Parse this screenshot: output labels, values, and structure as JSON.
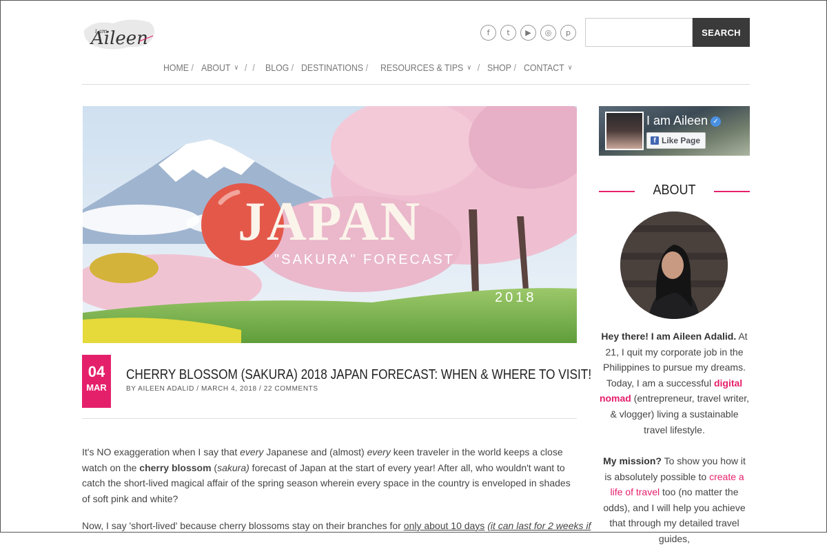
{
  "header": {
    "logo_alt": "I am Aileen",
    "logo_text_small": "i am",
    "logo_text": "Aileen",
    "social": [
      {
        "icon": "facebook-icon",
        "glyph": "f"
      },
      {
        "icon": "twitter-icon",
        "glyph": "t"
      },
      {
        "icon": "youtube-icon",
        "glyph": "▶"
      },
      {
        "icon": "instagram-icon",
        "glyph": "◎"
      },
      {
        "icon": "pinterest-icon",
        "glyph": "p"
      }
    ],
    "search": {
      "placeholder": "",
      "value": "",
      "button": "SEARCH"
    }
  },
  "nav": {
    "items": [
      {
        "label": "HOME",
        "has_dropdown": false
      },
      {
        "label": "ABOUT",
        "has_dropdown": true
      },
      {
        "label": "",
        "has_dropdown": false
      },
      {
        "label": "BLOG",
        "has_dropdown": false
      },
      {
        "label": "DESTINATIONS",
        "has_dropdown": false
      },
      {
        "label": "RESOURCES & TIPS",
        "has_dropdown": true
      },
      {
        "label": "",
        "has_dropdown": false
      },
      {
        "label": "SHOP",
        "has_dropdown": false
      },
      {
        "label": "CONTACT",
        "has_dropdown": true
      }
    ],
    "separator": "/"
  },
  "hero": {
    "title": "JAPAN",
    "year": "2018",
    "subtitle": "\"SAKURA\" FORECAST"
  },
  "post": {
    "date_day": "04",
    "date_month": "MAR",
    "title": "CHERRY BLOSSOM (SAKURA) 2018 JAPAN FORECAST: WHEN & WHERE TO VISIT!",
    "meta": "BY AILEEN ADALID / MARCH 4, 2018 / 22 COMMENTS",
    "p1": {
      "a": "It's NO exaggeration when I say that ",
      "b": "every",
      "c": " Japanese and (almost) ",
      "d": "every",
      "e": " keen traveler in the world keeps a close watch on the ",
      "f": "cherry blossom",
      "g": " (",
      "h": "sakura)",
      "i": " forecast of Japan at the start of every year! After all, who wouldn't want to catch the short-lived magical affair of the spring season wherein every space in the country is enveloped in shades of soft pink and white?"
    },
    "p2": {
      "a": "Now, I say 'short-lived' because cherry blossoms stay on their branches for ",
      "b": "only about 10 days",
      "c": " ",
      "d": "(it can last for 2 weeks if"
    }
  },
  "sidebar": {
    "fb": {
      "name": "I am Aileen",
      "like": "Like Page"
    },
    "about_title": "ABOUT",
    "bio1": {
      "greet": "Hey there! I am Aileen Adalid.",
      "t1": " At 21, I quit my corporate job in the Philippines to pursue my dreams. Today, I am a successful ",
      "link": "digital nomad",
      "t2": " (entrepreneur, travel writer, & vlogger) living a sustainable travel lifestyle."
    },
    "bio2": {
      "mission": "My mission?",
      "t1": " To show you how it is absolutely possible to ",
      "link": "create a life of travel",
      "t2": " too (no matter the odds), and I will help you achieve that through my detailed travel guides,"
    }
  },
  "colors": {
    "accent": "#e5206b",
    "search_button": "#3a3a3a"
  }
}
